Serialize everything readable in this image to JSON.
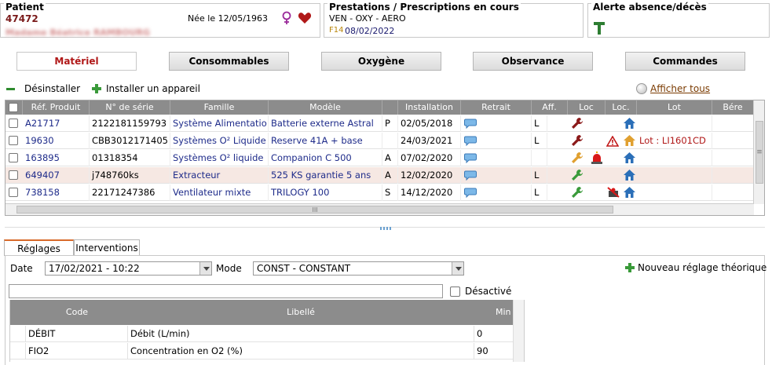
{
  "patient": {
    "title": "Patient",
    "id": "47472",
    "name": "Madame Béatrice RAMBOURG",
    "birth": "Née le 12/05/1963"
  },
  "prestations": {
    "title": "Prestations / Prescriptions en cours",
    "line": "VEN - OXY - AERO",
    "code": "F14",
    "date": "08/02/2022"
  },
  "alerte": {
    "title": "Alerte absence/décès"
  },
  "tabs": [
    "Matériel",
    "Consommables",
    "Oxygène",
    "Observance",
    "Commandes"
  ],
  "actions": {
    "uninstall": "Désinstaller",
    "install": "Installer un appareil",
    "show_all": "Afficher tous"
  },
  "grid": {
    "columns": [
      "Réf. Produit",
      "N° de série",
      "Famille",
      "Modèle",
      "Installation",
      "Retrait",
      "Aff.",
      "Loc",
      "Loc.",
      "Lot",
      "Bére"
    ],
    "rows": [
      {
        "ref": "A21717",
        "serial": "2122181159793",
        "famille": "Système Alimentatio",
        "modele": "Batterie externe Astral",
        "flag": "P",
        "installation": "02/05/2018",
        "aff": "L",
        "lot": ""
      },
      {
        "ref": "19630",
        "serial": "CBB3012171405",
        "famille": "Systèmes O² Liquide",
        "modele": "Reserve 41A + base",
        "flag": "",
        "installation": "24/03/2021",
        "aff": "L",
        "lot": "Lot : LI1601CD"
      },
      {
        "ref": "163895",
        "serial": "01318354",
        "famille": "Systèmes O² liquide",
        "modele": "Companion C 500",
        "flag": "A",
        "installation": "07/02/2020",
        "aff": "",
        "lot": ""
      },
      {
        "ref": "649407",
        "serial": "j748760ks",
        "famille": "Extracteur",
        "modele": "525 KS garantie 5 ans",
        "flag": "A",
        "installation": "12/02/2020",
        "aff": "L",
        "lot": ""
      },
      {
        "ref": "738158",
        "serial": "22171247386",
        "famille": "Ventilateur mixte",
        "modele": "TRILOGY 100",
        "flag": "S",
        "installation": "14/12/2020",
        "aff": "L",
        "lot": ""
      }
    ],
    "hscroll_glyph": "III",
    "vscroll_glyph": "≡"
  },
  "subtabs": [
    "Réglages",
    "Interventions"
  ],
  "reglages": {
    "date_label": "Date",
    "date_value": "17/02/2021 - 10:22",
    "mode_label": "Mode",
    "mode_value": "CONST - CONSTANT",
    "new_label": "Nouveau réglage théorique",
    "desactive_label": "Désactivé",
    "columns": [
      "Code",
      "Libellé",
      "Min"
    ],
    "rows": [
      {
        "code": "DÉBIT",
        "libelle": "Débit (L/min)",
        "min": "0"
      },
      {
        "code": "FIO2",
        "libelle": "Concentration en O2 (%)",
        "min": "90"
      }
    ]
  },
  "colors": {
    "accent_red": "#b01818",
    "link_blue": "#1e2b8a",
    "header_gray": "#8c8c8c",
    "selected_row": "#f6e8e3"
  }
}
